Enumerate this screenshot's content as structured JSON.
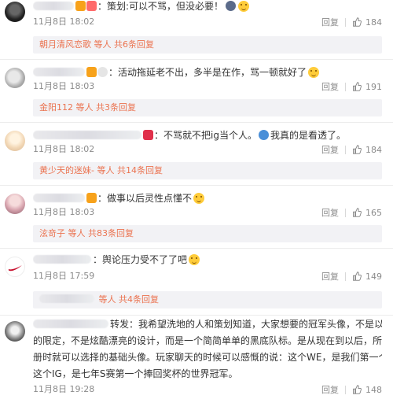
{
  "comments": [
    {
      "text": "策划:可以不骂，但没必要！",
      "time": "11月8日 18:02",
      "reply": "回复",
      "likes": "184",
      "sub": {
        "name": "朝月清风恋歌",
        "suffix": "等人  共6条回复"
      }
    },
    {
      "text": "活动拖延老不出，多半是在作，骂一顿就好了",
      "time": "11月8日 18:03",
      "reply": "回复",
      "likes": "191",
      "sub": {
        "name": "金阳112",
        "suffix": "等人 共3条回复"
      }
    },
    {
      "text": "不骂就不把ig当个人。",
      "text2": "我真的是看透了。",
      "time": "11月8日 18:02",
      "reply": "回复",
      "likes": "184",
      "sub": {
        "name": "黄少天的迷妹-",
        "suffix": "等人  共14条回复"
      }
    },
    {
      "text": "做事以后灵性点懂不",
      "time": "11月8日 18:03",
      "reply": "回复",
      "likes": "165",
      "sub": {
        "name": "泫竒子",
        "suffix": "等人  共83条回复"
      }
    },
    {
      "text": "舆论压力受不了了吧",
      "time": "11月8日 17:59",
      "reply": "回复",
      "likes": "149",
      "sub": {
        "name": "",
        "suffix": "等人  共4条回复"
      }
    },
    {
      "prefix": "转发",
      "lines": [
        "我希望洗地的人和策划知道，大家想要的冠军头像，不是以后买不到",
        "的限定，不是炫酷漂亮的设计，而是一个简简单单的黑底队标。是从现在到以后，所有新玩家在注",
        "册时就可以选择的基础头像。玩家聊天的时候可以感慨的说：这个WE，是我们第一个世界冠军。",
        "这个IG，是七年S赛第一个捧回奖杯的世界冠军。"
      ],
      "time": "11月8日 19:28",
      "reply": "回复",
      "likes": "148"
    }
  ],
  "colors": {
    "link": "#eb7350",
    "meta": "#8b8b8b",
    "sub_bg": "#f2f2f5"
  }
}
